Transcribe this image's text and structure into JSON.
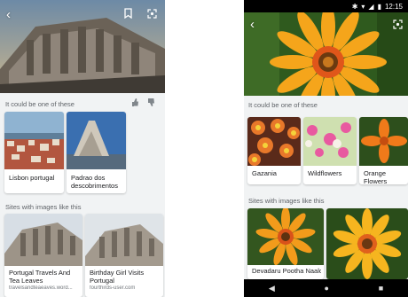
{
  "left_screen": {
    "section_1": "It could be one of these",
    "section_2": "Sites with images like this",
    "cards": [
      {
        "title": "Lisbon portugal"
      },
      {
        "title": "Padrao dos descobrimentos"
      }
    ],
    "sites": [
      {
        "title": "Portugal Travels And Tea Leaves",
        "source": "travelsandteaeaves.word..."
      },
      {
        "title": "Birthday Girl Visits Portugal",
        "source": "fourthirds-user.com"
      }
    ]
  },
  "right_screen": {
    "status_time": "12:15",
    "section_1": "It could be one of these",
    "section_2": "Sites with images like this",
    "cards": [
      {
        "title": "Gazania"
      },
      {
        "title": "Wildflowers"
      },
      {
        "title": "Orange Flowers"
      }
    ],
    "sites": [
      {
        "title": "Devadaru Pootha Naaloru"
      }
    ]
  },
  "icons": {
    "back": "back-arrow-icon",
    "bookmark": "bookmark-icon",
    "lens": "visual-search-icon",
    "thumbs_up": "thumbs-up-icon",
    "thumbs_down": "thumbs-down-icon"
  }
}
